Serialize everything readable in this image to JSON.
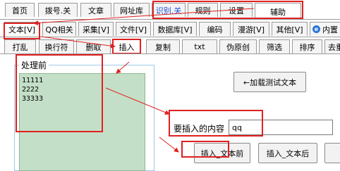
{
  "tabs_row1": [
    "首页",
    "拨号.关",
    "文章",
    "网址库",
    "识别.关",
    "规则",
    "设置",
    "辅助"
  ],
  "tabs_row2": [
    "文本[V]",
    "QQ相关",
    "采集[V]",
    "文件[V]",
    "数据库[V]",
    "编码",
    "漫游[V]",
    "其他[V]",
    "内置"
  ],
  "tabs_row3": [
    "打乱",
    "换行符",
    "删取",
    "插入",
    "复制",
    "txt",
    "伪原创",
    "筛选",
    "排序",
    "去重"
  ],
  "group": {
    "title": "处理前",
    "lines": [
      "11111",
      "2222",
      "33333"
    ]
  },
  "load_test_button": "←加载测试文本",
  "insert": {
    "label": "要插入的内容",
    "value": "qq",
    "before_button": "插入_文本前",
    "after_button": "插入_文本后"
  },
  "colors": {
    "highlight_text": "#1a4fd8",
    "annotation_red": "#e02020",
    "text_area_green": "#c4dfc7"
  }
}
